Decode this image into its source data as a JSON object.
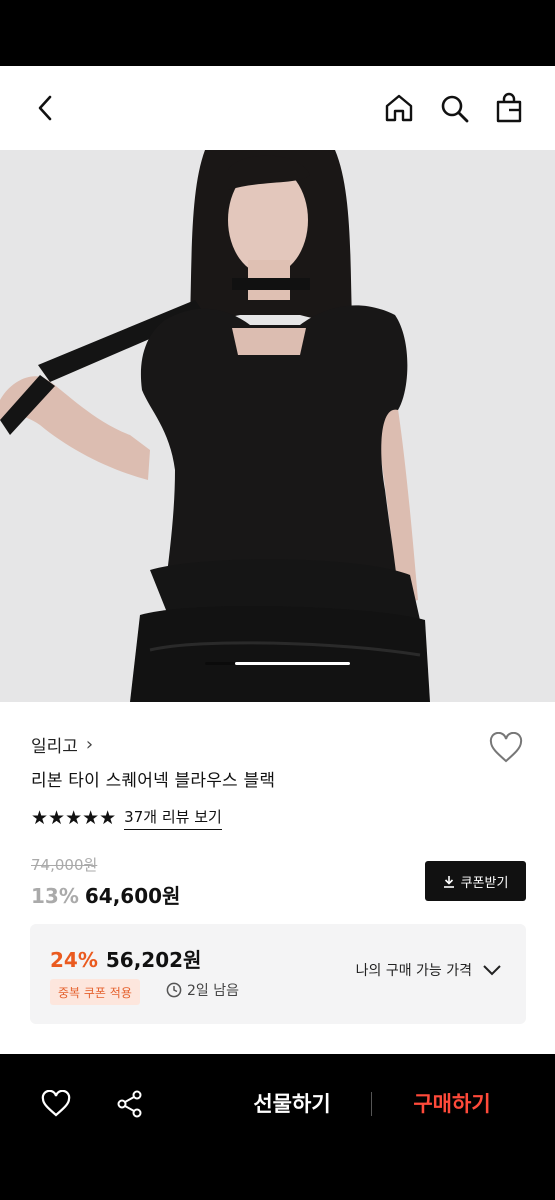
{
  "header": {
    "icons": [
      "chevron-left-icon",
      "home-icon",
      "search-icon",
      "shopping-bag-icon"
    ]
  },
  "product": {
    "brand": "일리고",
    "brand_chevron": "›",
    "title": "리본 타이 스퀘어넥 블라우스 블랙",
    "rating": 5,
    "rating_stars": "★★★★★",
    "review_link": "37개 리뷰 보기",
    "original_price": "74,000원",
    "discount_rate": "13%",
    "price": "64,600원",
    "image_slide_progress": 0.79
  },
  "coupon": {
    "label": "쿠폰받기",
    "icon": "download-icon"
  },
  "my_price": {
    "discount_rate": "24%",
    "price": "56,202원",
    "badge": "중복 쿠폰 적용",
    "timer": "2일 남음",
    "link_label": "나의 구매 가능 가격"
  },
  "bottom_bar": {
    "gift_label": "선물하기",
    "buy_label": "구매하기"
  },
  "colors": {
    "accent_orange": "#ea5a1f",
    "buy_red": "#ff4a3a",
    "badge_bg": "#fde6dd"
  }
}
